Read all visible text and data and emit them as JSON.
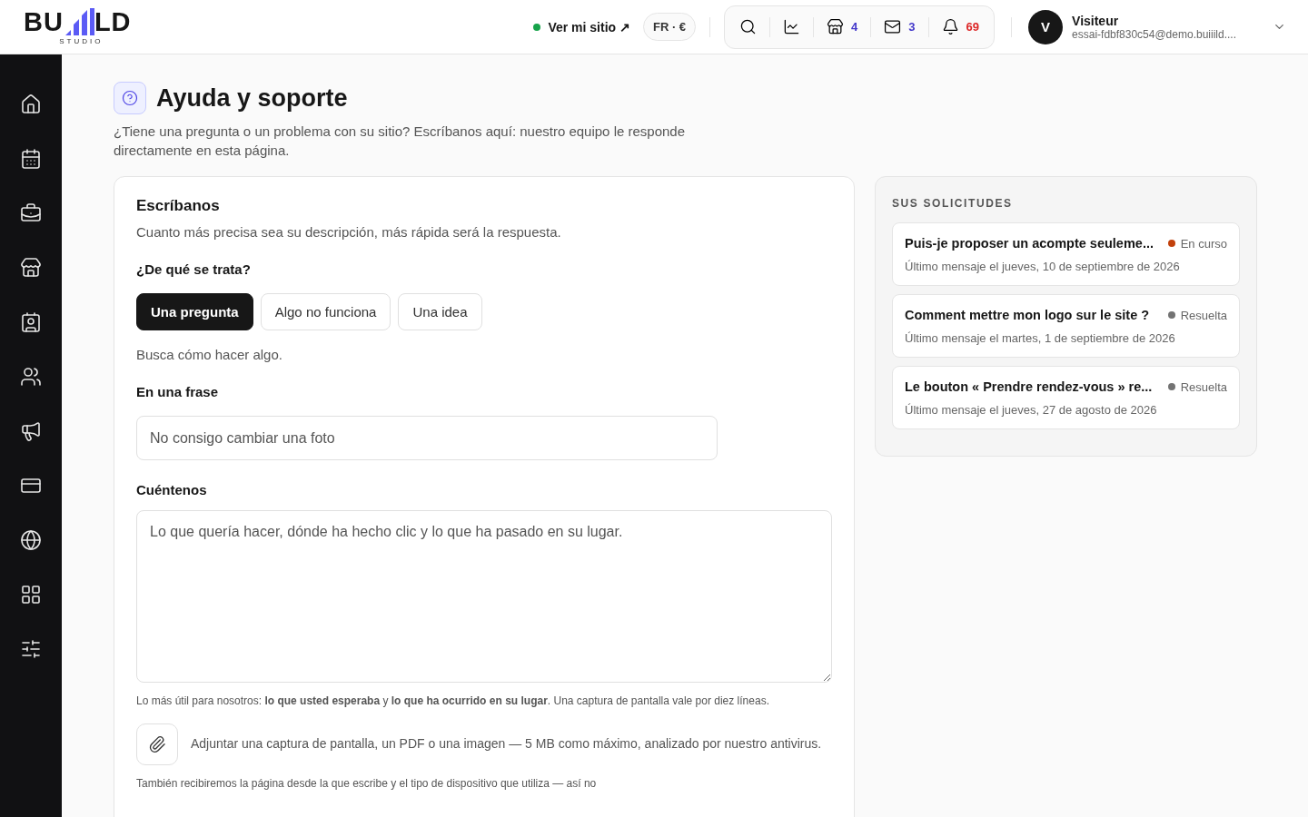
{
  "logo": {
    "left": "BU",
    "right": "LD",
    "sub": "STUDIO"
  },
  "topbar": {
    "site_link": "Ver mi sitio ↗",
    "site_online": true,
    "locale": "FR · €",
    "tools": [
      {
        "kind": "search"
      },
      {
        "kind": "stats"
      },
      {
        "kind": "store",
        "count": "4",
        "color": "#4338ca"
      },
      {
        "kind": "mail",
        "count": "3",
        "color": "#4338ca"
      },
      {
        "kind": "bell",
        "count": "69",
        "color": "#dc2626"
      }
    ],
    "user": {
      "initial": "V",
      "name": "Visiteur",
      "email": "essai-fdbf830c54@demo.buiiild...."
    }
  },
  "sidebar": {
    "items": [
      {
        "kind": "home"
      },
      {
        "kind": "calendar"
      },
      {
        "kind": "toolbox"
      },
      {
        "kind": "store"
      },
      {
        "kind": "contact"
      },
      {
        "kind": "users"
      },
      {
        "kind": "megaphone"
      },
      {
        "kind": "card"
      },
      {
        "kind": "globe"
      },
      {
        "kind": "apps"
      },
      {
        "kind": "sliders"
      }
    ]
  },
  "page": {
    "title": "Ayuda y soporte",
    "subtitle": "¿Tiene una pregunta o un problema con su sitio? Escríbanos aquí: nuestro equipo le responde directamente en esta página."
  },
  "form": {
    "title": "Escríbanos",
    "intro": "Cuanto más precisa sea su descripción, más rápida será la respuesta.",
    "type_label": "¿De qué se trata?",
    "types": [
      {
        "label": "Una pregunta",
        "selected": true
      },
      {
        "label": "Algo no funciona",
        "selected": false
      },
      {
        "label": "Una idea",
        "selected": false
      }
    ],
    "type_hint": "Busca cómo hacer algo.",
    "phrase_label": "En una frase",
    "phrase_placeholder": "No consigo cambiar una foto",
    "details_label": "Cuéntenos",
    "details_placeholder": "Lo que quería hacer, dónde ha hecho clic y lo que ha pasado en su lugar.",
    "details_hint": "Lo más útil para nosotros: **lo que usted esperaba** y **lo que ha ocurrido en su lugar**. Una captura de pantalla vale por diez líneas.",
    "attach_text": "Adjuntar una captura de pantalla, un PDF o una imagen — 5 MB como máximo, analizado por nuestro antivirus.",
    "footer_note": "También recibiremos la página desde la que escribe y el tipo de dispositivo que utiliza — así no"
  },
  "requests": {
    "title": "SUS SOLICITUDES",
    "items": [
      {
        "title": "Puis-je proposer un acompte seuleme...",
        "status": "En curso",
        "color": "#c2410c",
        "date": "Último mensaje el jueves, 10 de septiembre de 2026"
      },
      {
        "title": "Comment mettre mon logo sur le site ?",
        "status": "Resuelta",
        "color": "#737373",
        "date": "Último mensaje el martes, 1 de septiembre de 2026"
      },
      {
        "title": "Le bouton « Prendre rendez-vous » re...",
        "status": "Resuelta",
        "color": "#737373",
        "date": "Último mensaje el jueves, 27 de agosto de 2026"
      }
    ]
  }
}
